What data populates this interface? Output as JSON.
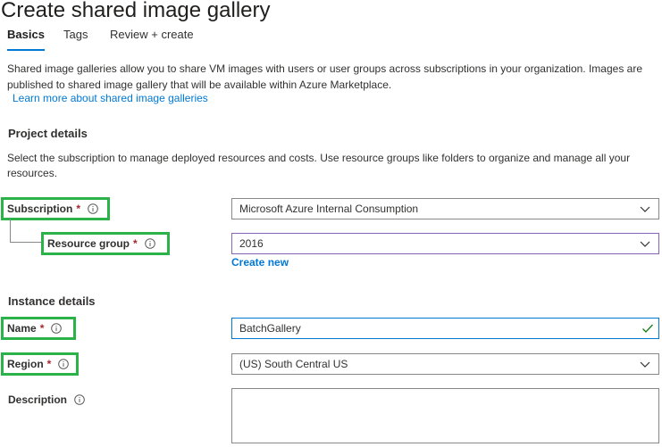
{
  "page": {
    "title": "Create shared image gallery"
  },
  "tabs": [
    {
      "label": "Basics",
      "active": true
    },
    {
      "label": "Tags",
      "active": false
    },
    {
      "label": "Review + create",
      "active": false
    }
  ],
  "intro": {
    "text": "Shared image galleries allow you to share VM images with users or user groups across subscriptions in your organization. Images are published to shared image gallery that will be available within Azure Marketplace.",
    "link": "Learn more about shared image galleries"
  },
  "project": {
    "heading": "Project details",
    "description": "Select the subscription to manage deployed resources and costs. Use resource groups like folders to organize and manage all your resources.",
    "subscription": {
      "label": "Subscription",
      "required": "*",
      "value": "Microsoft Azure Internal Consumption"
    },
    "resource_group": {
      "label": "Resource group",
      "required": "*",
      "value": "2016",
      "create_new": "Create new"
    }
  },
  "instance": {
    "heading": "Instance details",
    "name": {
      "label": "Name",
      "required": "*",
      "value": "BatchGallery"
    },
    "region": {
      "label": "Region",
      "required": "*",
      "value": "(US) South Central US"
    },
    "description": {
      "label": "Description",
      "value": ""
    }
  },
  "colors": {
    "accent": "#0078d4",
    "highlight_box": "#2bb34a",
    "required": "#a4262c",
    "valid_check": "#107c10"
  },
  "icons": {
    "info": "info-icon",
    "chevron": "chevron-down-icon",
    "valid": "checkmark-icon"
  }
}
